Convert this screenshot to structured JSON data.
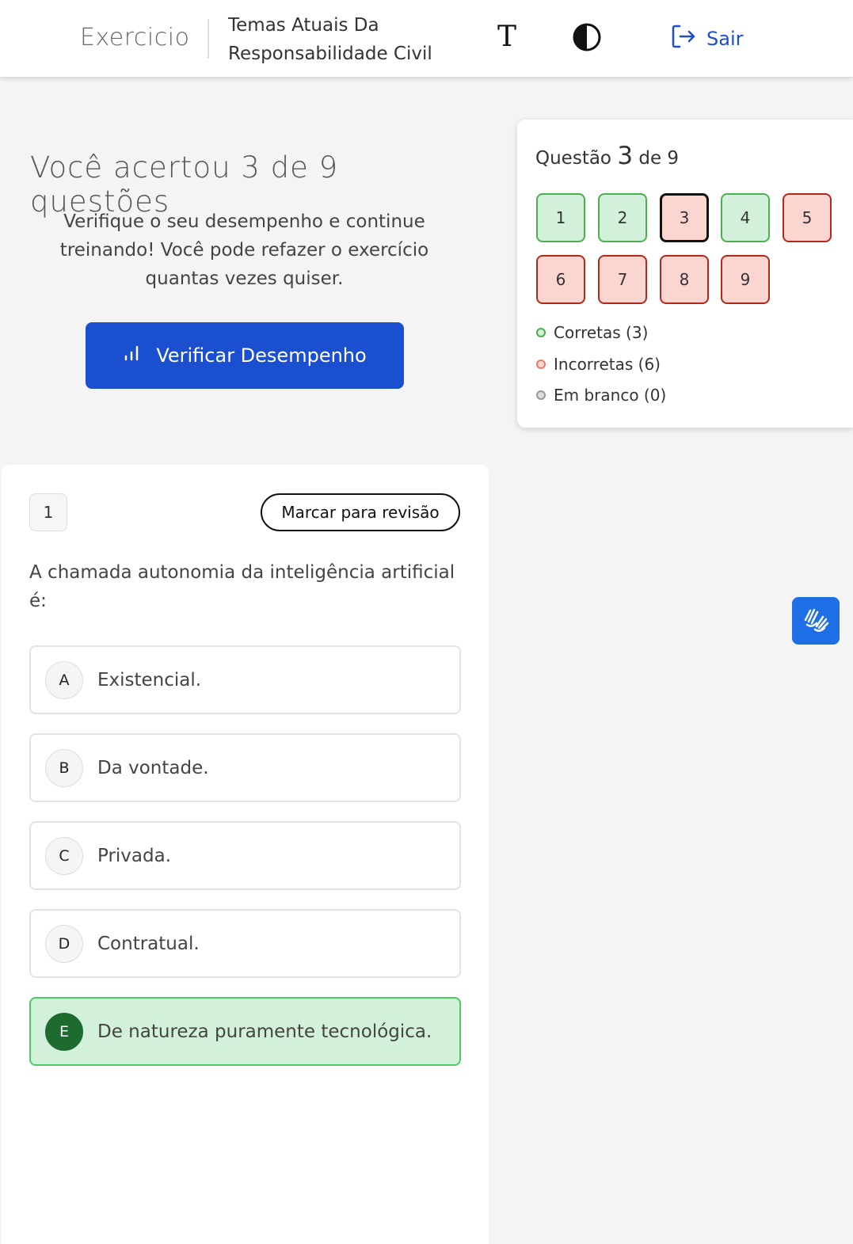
{
  "header": {
    "brand": "Exercicio",
    "course_title": "Temas Atuais Da Responsabilidade Civil",
    "font_glyph": "T",
    "logout_label": "Sair"
  },
  "result": {
    "title": "Você acertou 3 de 9 questões",
    "subtitle": "Verifique o seu desempenho e continue treinando! Você pode refazer o exercício quantas vezes quiser.",
    "button_label": "Verificar Desempenho"
  },
  "question_nav": {
    "prefix": "Questão",
    "current": "3",
    "suffix": "de 9",
    "questions": [
      {
        "label": "1",
        "status": "correct"
      },
      {
        "label": "2",
        "status": "correct"
      },
      {
        "label": "3",
        "status": "wrong",
        "current": true
      },
      {
        "label": "4",
        "status": "correct"
      },
      {
        "label": "5",
        "status": "wrong"
      },
      {
        "label": "6",
        "status": "wrong"
      },
      {
        "label": "7",
        "status": "wrong"
      },
      {
        "label": "8",
        "status": "wrong"
      },
      {
        "label": "9",
        "status": "wrong"
      }
    ],
    "legend": {
      "correct": "Corretas (3)",
      "wrong": "Incorretas (6)",
      "blank": "Em branco (0)"
    }
  },
  "question": {
    "number": "1",
    "mark_label": "Marcar para revisão",
    "text": "A chamada autonomia da inteligência artificial é:",
    "options": [
      {
        "letter": "A",
        "text": "Existencial."
      },
      {
        "letter": "B",
        "text": "Da vontade."
      },
      {
        "letter": "C",
        "text": "Privada."
      },
      {
        "letter": "D",
        "text": "Contratual."
      },
      {
        "letter": "E",
        "text": "De natureza puramente tecnológica.",
        "selected": true
      }
    ]
  },
  "colors": {
    "primary": "#1a4fd0",
    "correct_bg": "#d3f0da",
    "correct_border": "#4caf50",
    "wrong_bg": "#fbd5d0",
    "wrong_border": "#b4281c",
    "selected_letter_bg": "#1e6b2f"
  }
}
